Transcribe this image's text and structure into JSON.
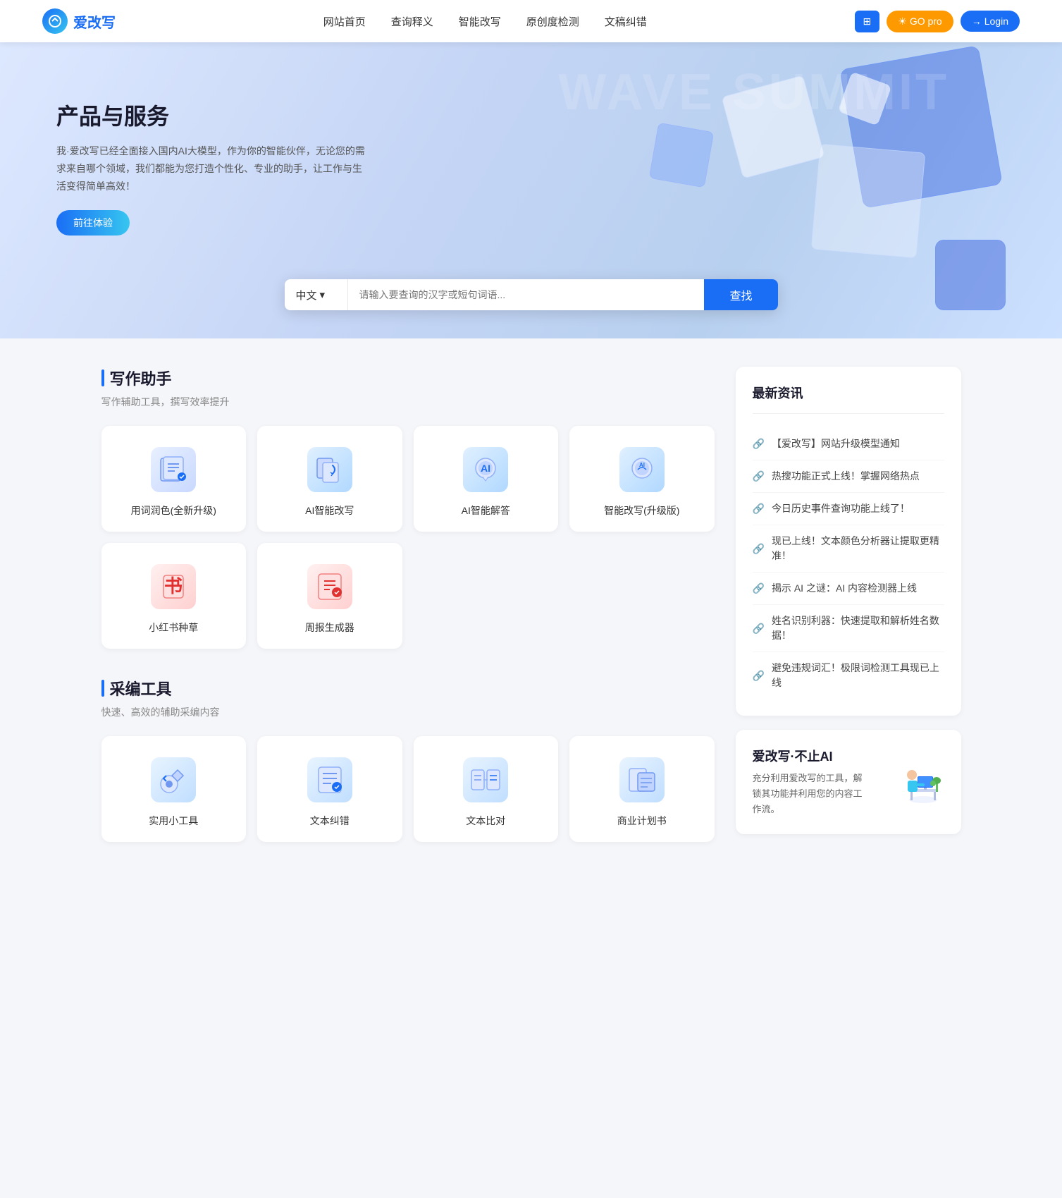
{
  "header": {
    "logo_text": "爱改写",
    "nav_items": [
      {
        "label": "网站首页",
        "id": "home"
      },
      {
        "label": "查询释义",
        "id": "query"
      },
      {
        "label": "智能改写",
        "id": "rewrite"
      },
      {
        "label": "原创度检测",
        "id": "original"
      },
      {
        "label": "文稿纠错",
        "id": "proofread"
      }
    ],
    "btn_grid_label": "⊞",
    "btn_go_label": "GO pro",
    "btn_login_label": "Login"
  },
  "hero": {
    "title": "产品与服务",
    "desc": "我·爱改写已经全面接入国内AI大模型，作为你的智能伙伴，无论您的需求来自哪个领域，我们都能为您打造个性化、专业的助手，让工作与生活变得简单高效！",
    "btn_label": "前往体验",
    "wave_text": "WAVE SUMMIT",
    "search": {
      "lang": "中文",
      "placeholder": "请输入要查询的汉字或短句词语...",
      "btn_label": "查找"
    }
  },
  "writing_section": {
    "title": "写作助手",
    "subtitle": "写作辅助工具，撰写效率提升",
    "tools": [
      {
        "id": "word-color",
        "label": "用词润色(全新升级)",
        "icon": "writing"
      },
      {
        "id": "ai-rewrite",
        "label": "AI智能改写",
        "icon": "ai-rewrite"
      },
      {
        "id": "ai-answer",
        "label": "AI智能解答",
        "icon": "ai-answer"
      },
      {
        "id": "smart-rewrite",
        "label": "智能改写(升级版)",
        "icon": "smart-rewrite"
      },
      {
        "id": "xiaohongshu",
        "label": "小红书种草",
        "icon": "xiaohongshu"
      },
      {
        "id": "weekly-report",
        "label": "周报生成器",
        "icon": "weekly-report"
      }
    ]
  },
  "caibiantools_section": {
    "title": "采编工具",
    "subtitle": "快速、高效的辅助采编内容",
    "tools": [
      {
        "id": "utility-tools",
        "label": "实用小工具",
        "icon": "utility"
      },
      {
        "id": "text-proofread",
        "label": "文本纠错",
        "icon": "text-proofread"
      },
      {
        "id": "text-compare",
        "label": "文本比对",
        "icon": "text-compare"
      },
      {
        "id": "business-plan",
        "label": "商业计划书",
        "icon": "business-plan"
      }
    ]
  },
  "news": {
    "title": "最新资讯",
    "items": [
      {
        "text": "【爱改写】网站升级模型通知"
      },
      {
        "text": "热搜功能正式上线！掌握网络热点"
      },
      {
        "text": "今日历史事件查询功能上线了！"
      },
      {
        "text": "现已上线！文本颜色分析器让提取更精准！"
      },
      {
        "text": "揭示 AI 之谜：AI 内容检测器上线"
      },
      {
        "text": "姓名识别利器：快速提取和解析姓名数据！"
      },
      {
        "text": "避免违规词汇！极限词检测工具现已上线"
      }
    ]
  },
  "promo": {
    "title": "爱改写·不止AI",
    "desc": "充分利用爱改写的工具，解锁其功能并利用您的内容工作流。"
  }
}
